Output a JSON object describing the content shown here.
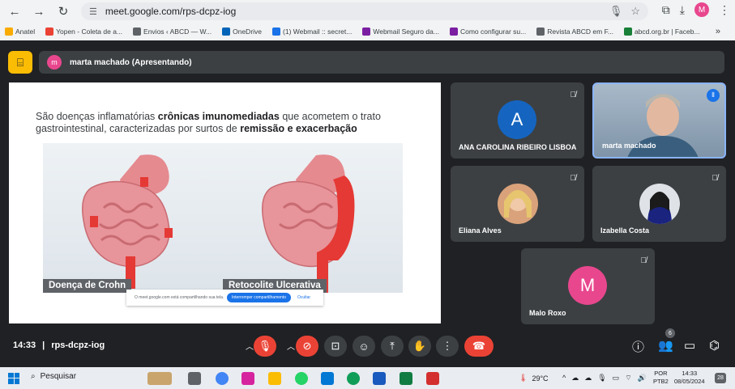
{
  "browser": {
    "url": "meet.google.com/rps-dcpz-iog",
    "bookmarks": [
      {
        "label": "Anatel",
        "color": "#f9ab00"
      },
      {
        "label": "Yopen - Coleta de a...",
        "color": "#ea4335"
      },
      {
        "label": "Envios ‹ ABCD — W...",
        "color": "#5f6368"
      },
      {
        "label": "OneDrive",
        "color": "#0364b8"
      },
      {
        "label": "(1) Webmail :: secret...",
        "color": "#1a73e8"
      },
      {
        "label": "Webmail Seguro da...",
        "color": "#7b1fa2"
      },
      {
        "label": "Como configurar su...",
        "color": "#7b1fa2"
      },
      {
        "label": "Revista ABCD em F...",
        "color": "#5f6368"
      },
      {
        "label": "abcd.org.br | Faceb...",
        "color": "#188038"
      }
    ]
  },
  "meet": {
    "presenter_label": "marta machado (Apresentando)",
    "presenter_initial": "m",
    "slide": {
      "line1_pre": "São doenças inflamatórias ",
      "line1_bold": "crônicas imunomediadas",
      "line1_post": " que acometem o trato",
      "line2_pre": "gastrointestinal, caracterizadas por surtos de ",
      "line2_bold": "remissão e exacerbação",
      "caption_left": "Doença de Crohn",
      "caption_right": "Retocolite Ulcerativa",
      "share_message": "O meet.google.com está compartilhando sua tela.",
      "share_stop": "Interromper compartilhamento",
      "share_hide": "Ocultar"
    },
    "participants": [
      {
        "name": "ANA CAROLINA RIBEIRO LISBOA",
        "initial": "A",
        "color": "#1565c0"
      },
      {
        "name": "marta machado"
      },
      {
        "name": "Eliana Alves"
      },
      {
        "name": "Izabella Costa"
      },
      {
        "name": "Malo Roxo",
        "initial": "M",
        "color": "#e8478e"
      }
    ],
    "time": "14:33",
    "meeting_code": "rps-dcpz-iog",
    "people_count": "6"
  },
  "taskbar": {
    "search_label": "Pesquisar",
    "temperature": "29°C",
    "lang_line1": "POR",
    "lang_line2": "PTB2",
    "clock_time": "14:33",
    "clock_date": "08/05/2024",
    "notifications": "28"
  }
}
